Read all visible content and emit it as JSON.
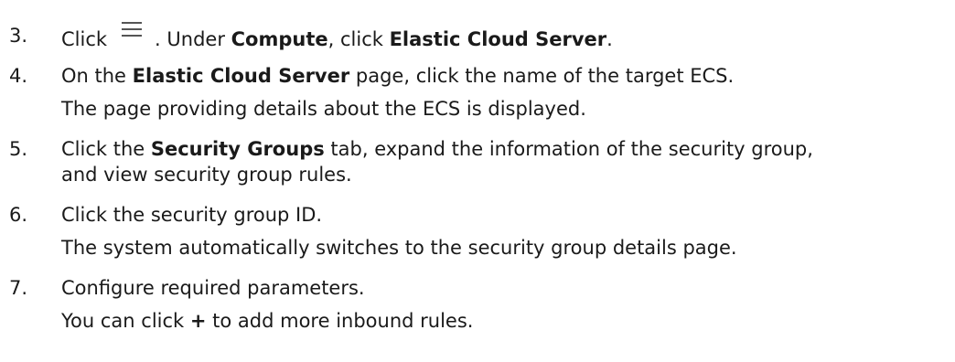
{
  "steps": [
    {
      "number": "3.",
      "click": "Click",
      "icon": "menu-icon",
      "under": ". Under ",
      "compute": "Compute",
      "click2": ", click ",
      "ecs": "Elastic Cloud Server",
      "period": "."
    },
    {
      "number": "4.",
      "on_the": "On the ",
      "ecs_page": "Elastic Cloud Server",
      "rest": " page, click the name of the target ECS.",
      "result": "The page providing details about the ECS is displayed."
    },
    {
      "number": "5.",
      "click_the": "Click the ",
      "tab_name": "Security Groups",
      "rest": " tab, expand the information of the security group,",
      "cont": "and view security group rules."
    },
    {
      "number": "6.",
      "text": "Click the security group ID.",
      "result": "The system automatically switches to the security group details page."
    },
    {
      "number": "7.",
      "text": "Configure required parameters.",
      "note_pre": "You can click ",
      "plus": "+",
      "note_post": " to add more inbound rules."
    }
  ]
}
